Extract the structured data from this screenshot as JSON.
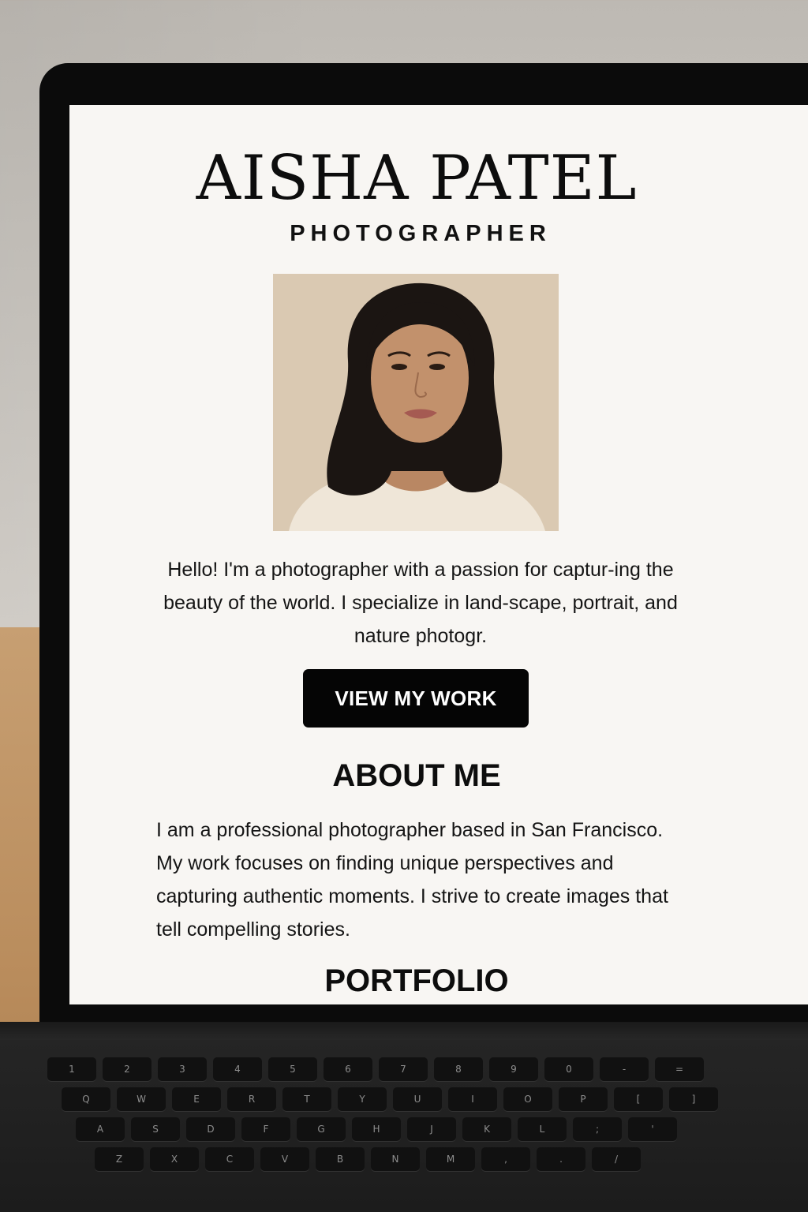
{
  "site": {
    "name": "AISHA PATEL",
    "role": "PHOTOGRAPHER",
    "portrait_alt": "portrait photo",
    "intro": "Hello! I'm a photographer with a passion for captur-ing the beauty of the world. I specialize in land-scape, portrait, and nature photogr.",
    "cta_label": "VIEW MY WORK",
    "about_heading": "ABOUT ME",
    "about_text": "I am a professional photographer based in San Francisco. My work focuses on finding unique perspectives and capturing authentic moments. I strive to create images that tell compelling stories.",
    "portfolio_heading": "PORTFOLIO"
  },
  "colors": {
    "page_bg": "#f8f6f3",
    "text": "#0d0d0d",
    "button_bg": "#050505",
    "button_text": "#ffffff"
  },
  "keyboard": {
    "row1": [
      "1",
      "2",
      "3",
      "4",
      "5",
      "6",
      "7",
      "8",
      "9",
      "0",
      "-",
      "="
    ],
    "row2": [
      "Q",
      "W",
      "E",
      "R",
      "T",
      "Y",
      "U",
      "I",
      "O",
      "P",
      "[",
      "]"
    ],
    "row3": [
      "A",
      "S",
      "D",
      "F",
      "G",
      "H",
      "J",
      "K",
      "L",
      ";",
      "'"
    ],
    "row4": [
      "Z",
      "X",
      "C",
      "V",
      "B",
      "N",
      "M",
      ",",
      ".",
      "/"
    ]
  }
}
